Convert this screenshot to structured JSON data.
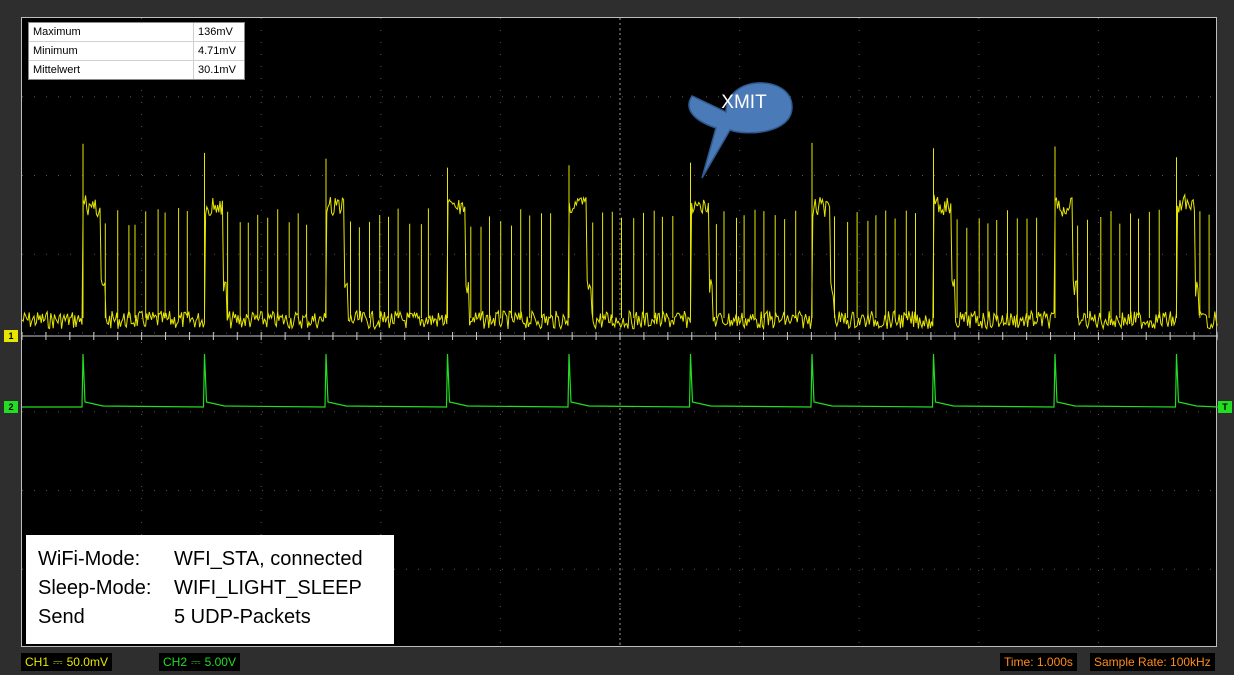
{
  "measurements": [
    {
      "label": "Maximum",
      "value": "136mV"
    },
    {
      "label": "Minimum",
      "value": "4.71mV"
    },
    {
      "label": "Mittelwert",
      "value": "30.1mV"
    }
  ],
  "callout": "XMIT",
  "info": [
    {
      "key": "WiFi-Mode:",
      "value": "WFI_STA, connected"
    },
    {
      "key": "Sleep-Mode:",
      "value": "WIFI_LIGHT_SLEEP"
    },
    {
      "key": "Send",
      "value": "5 UDP-Packets"
    }
  ],
  "markers": {
    "ch1": "1",
    "ch2": "2",
    "trigger": "T"
  },
  "status": {
    "ch1_label": "CH1",
    "ch1_coupling": "⎓",
    "ch1_scale": "50.0mV",
    "ch2_label": "CH2",
    "ch2_coupling": "⎓",
    "ch2_scale": "5.00V",
    "time": "Time: 1.000s",
    "sample_rate": "Sample Rate: 100kHz"
  },
  "colors": {
    "ch1": "#e6e600",
    "ch2": "#22dd22",
    "time_text": "#ff8c1a",
    "callout_fill": "#4a7ab8"
  }
}
